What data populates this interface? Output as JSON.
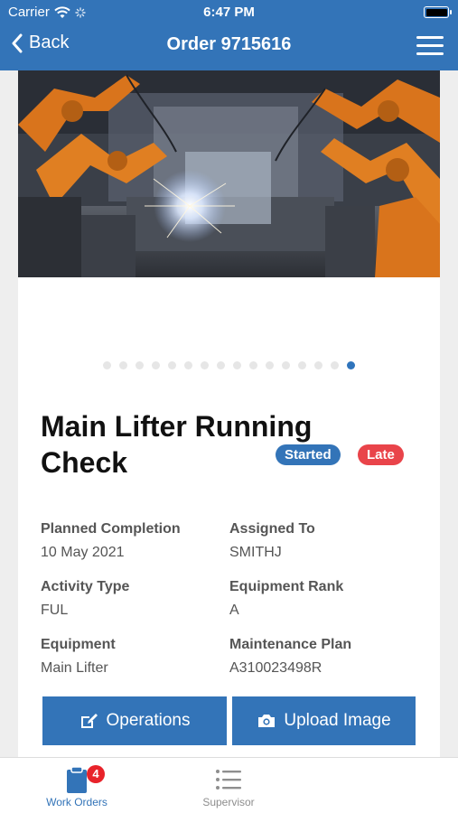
{
  "status_bar": {
    "carrier": "Carrier",
    "time": "6:47 PM"
  },
  "nav": {
    "back_label": "Back",
    "title": "Order 9715616"
  },
  "carousel": {
    "dot_count": 16,
    "active_index": 15
  },
  "order": {
    "title": "Main Lifter Running Check",
    "status_badge": "Started",
    "late_badge": "Late"
  },
  "details": {
    "planned_completion": {
      "label": "Planned Completion",
      "value": "10 May 2021"
    },
    "assigned_to": {
      "label": "Assigned To",
      "value": "SMITHJ"
    },
    "activity_type": {
      "label": "Activity Type",
      "value": "FUL"
    },
    "equipment_rank": {
      "label": "Equipment Rank",
      "value": "A"
    },
    "equipment": {
      "label": "Equipment",
      "value": "Main Lifter"
    },
    "maintenance_plan": {
      "label": "Maintenance Plan",
      "value": "A310023498R"
    }
  },
  "actions": {
    "operations_label": "Operations",
    "upload_label": "Upload Image"
  },
  "tabbar": {
    "work_orders_label": "Work Orders",
    "work_orders_count": "4",
    "supervisor_label": "Supervisor"
  },
  "colors": {
    "brand": "#3374b8",
    "late": "#e9444a",
    "badge": "#e8232a"
  },
  "icons": [
    "wifi-icon",
    "activity-icon",
    "battery-icon",
    "back-chevron-icon",
    "menu-icon",
    "edit-icon",
    "camera-icon",
    "clipboard-icon",
    "list-icon"
  ]
}
